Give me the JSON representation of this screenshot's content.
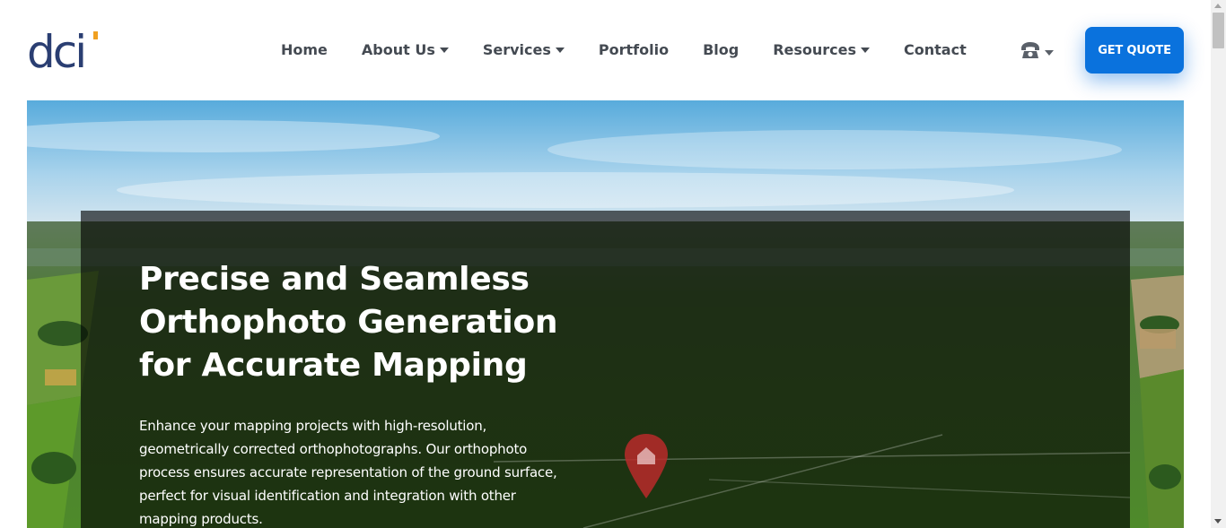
{
  "brand": {
    "logo_text": "dci",
    "accent": "#f0a020",
    "color": "#2a3e72"
  },
  "nav": {
    "items": [
      {
        "label": "Home",
        "dropdown": false
      },
      {
        "label": "About Us",
        "dropdown": true
      },
      {
        "label": "Services",
        "dropdown": true
      },
      {
        "label": "Portfolio",
        "dropdown": false
      },
      {
        "label": "Blog",
        "dropdown": false
      },
      {
        "label": "Resources",
        "dropdown": true
      },
      {
        "label": "Contact",
        "dropdown": false
      }
    ]
  },
  "header": {
    "phone_icon": "☎",
    "cta_label": "GET QUOTE",
    "cta_color": "#0a72dd"
  },
  "hero": {
    "title": "Precise and Seamless Orthophoto Generation for Accurate Mapping",
    "description": "Enhance your mapping projects with high-resolution, geometrically corrected orthophotographs. Our orthophoto process ensures accurate representation of the ground surface, perfect for visual identification and integration with other mapping products."
  }
}
